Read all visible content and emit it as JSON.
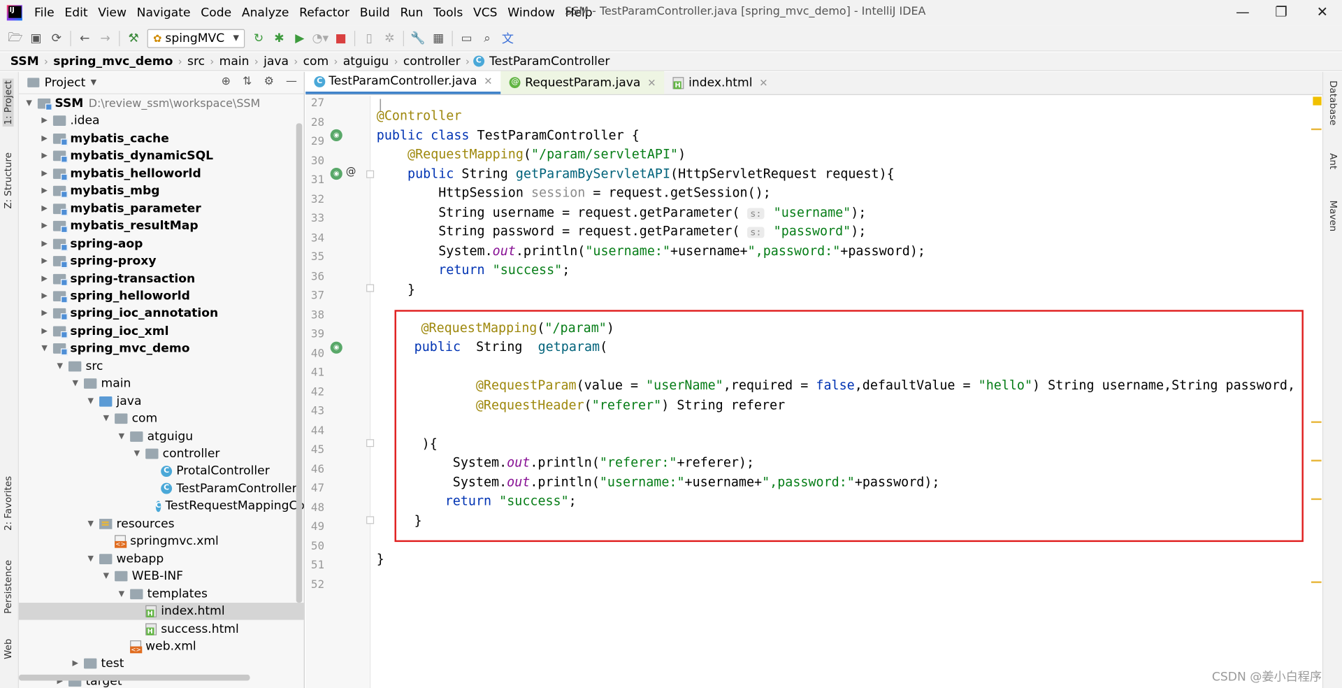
{
  "menubar": {
    "items": [
      "File",
      "Edit",
      "View",
      "Navigate",
      "Code",
      "Analyze",
      "Refactor",
      "Build",
      "Run",
      "Tools",
      "VCS",
      "Window",
      "Help"
    ],
    "title": "SSM - TestParamController.java [spring_mvc_demo] - IntelliJ IDEA"
  },
  "toolbar": {
    "run_config": "spingMVC"
  },
  "breadcrumb": [
    "SSM",
    "spring_mvc_demo",
    "src",
    "main",
    "java",
    "com",
    "atguigu",
    "controller",
    "TestParamController"
  ],
  "left_tabs": [
    "1: Project",
    "Z: Structure",
    "2: Favorites",
    "Persistence",
    "Web"
  ],
  "right_tabs": [
    "Database",
    "Ant",
    "Maven"
  ],
  "project": {
    "title": "Project",
    "root_path": "D:\\review_ssm\\workspace\\SSM",
    "tree": [
      {
        "label": "SSM",
        "type": "module",
        "bold": true,
        "arrow": "down",
        "indent": 0
      },
      {
        "label": ".idea",
        "type": "folder",
        "bold": false,
        "arrow": "right",
        "indent": 1
      },
      {
        "label": "mybatis_cache",
        "type": "module",
        "bold": true,
        "arrow": "right",
        "indent": 1
      },
      {
        "label": "mybatis_dynamicSQL",
        "type": "module",
        "bold": true,
        "arrow": "right",
        "indent": 1
      },
      {
        "label": "mybatis_helloworld",
        "type": "module",
        "bold": true,
        "arrow": "right",
        "indent": 1
      },
      {
        "label": "mybatis_mbg",
        "type": "module",
        "bold": true,
        "arrow": "right",
        "indent": 1
      },
      {
        "label": "mybatis_parameter",
        "type": "module",
        "bold": true,
        "arrow": "right",
        "indent": 1
      },
      {
        "label": "mybatis_resultMap",
        "type": "module",
        "bold": true,
        "arrow": "right",
        "indent": 1
      },
      {
        "label": "spring-aop",
        "type": "module",
        "bold": true,
        "arrow": "right",
        "indent": 1
      },
      {
        "label": "spring-proxy",
        "type": "module",
        "bold": true,
        "arrow": "right",
        "indent": 1
      },
      {
        "label": "spring-transaction",
        "type": "module",
        "bold": true,
        "arrow": "right",
        "indent": 1
      },
      {
        "label": "spring_helloworld",
        "type": "module",
        "bold": true,
        "arrow": "right",
        "indent": 1
      },
      {
        "label": "spring_ioc_annotation",
        "type": "module",
        "bold": true,
        "arrow": "right",
        "indent": 1
      },
      {
        "label": "spring_ioc_xml",
        "type": "module",
        "bold": true,
        "arrow": "right",
        "indent": 1
      },
      {
        "label": "spring_mvc_demo",
        "type": "module",
        "bold": true,
        "arrow": "down",
        "indent": 1
      },
      {
        "label": "src",
        "type": "folder",
        "bold": false,
        "arrow": "down",
        "indent": 2
      },
      {
        "label": "main",
        "type": "folder",
        "bold": false,
        "arrow": "down",
        "indent": 3
      },
      {
        "label": "java",
        "type": "folder-blue",
        "bold": false,
        "arrow": "down",
        "indent": 4
      },
      {
        "label": "com",
        "type": "folder",
        "bold": false,
        "arrow": "down",
        "indent": 5
      },
      {
        "label": "atguigu",
        "type": "folder",
        "bold": false,
        "arrow": "down",
        "indent": 6
      },
      {
        "label": "controller",
        "type": "folder",
        "bold": false,
        "arrow": "down",
        "indent": 7
      },
      {
        "label": "ProtalController",
        "type": "class",
        "bold": false,
        "arrow": "",
        "indent": 8
      },
      {
        "label": "TestParamController",
        "type": "class",
        "bold": false,
        "arrow": "",
        "indent": 8
      },
      {
        "label": "TestRequestMappingCo",
        "type": "class",
        "bold": false,
        "arrow": "",
        "indent": 8
      },
      {
        "label": "resources",
        "type": "resources",
        "bold": false,
        "arrow": "down",
        "indent": 4
      },
      {
        "label": "springmvc.xml",
        "type": "xml",
        "bold": false,
        "arrow": "",
        "indent": 5
      },
      {
        "label": "webapp",
        "type": "folder",
        "bold": false,
        "arrow": "down",
        "indent": 4
      },
      {
        "label": "WEB-INF",
        "type": "folder",
        "bold": false,
        "arrow": "down",
        "indent": 5
      },
      {
        "label": "templates",
        "type": "folder",
        "bold": false,
        "arrow": "down",
        "indent": 6
      },
      {
        "label": "index.html",
        "type": "html",
        "bold": false,
        "arrow": "",
        "indent": 7,
        "selected": true
      },
      {
        "label": "success.html",
        "type": "html",
        "bold": false,
        "arrow": "",
        "indent": 7
      },
      {
        "label": "web.xml",
        "type": "xml",
        "bold": false,
        "arrow": "",
        "indent": 6
      },
      {
        "label": "test",
        "type": "folder",
        "bold": false,
        "arrow": "right",
        "indent": 3
      },
      {
        "label": "target",
        "type": "folder",
        "bold": false,
        "arrow": "right",
        "indent": 2
      }
    ]
  },
  "tabs": [
    {
      "label": "TestParamController.java",
      "icon": "class",
      "active": true
    },
    {
      "label": "RequestParam.java",
      "icon": "annotation",
      "active": false
    },
    {
      "label": "index.html",
      "icon": "html",
      "active": false
    }
  ],
  "editor": {
    "line_numbers": [
      "27",
      "28",
      "29",
      "30",
      "31",
      "32",
      "33",
      "34",
      "35",
      "36",
      "37",
      "38",
      "39",
      "40",
      "41",
      "42",
      "43",
      "44",
      "45",
      "46",
      "47",
      "48",
      "49",
      "50",
      "51",
      "52"
    ]
  },
  "watermark": "CSDN @姜小白程序"
}
